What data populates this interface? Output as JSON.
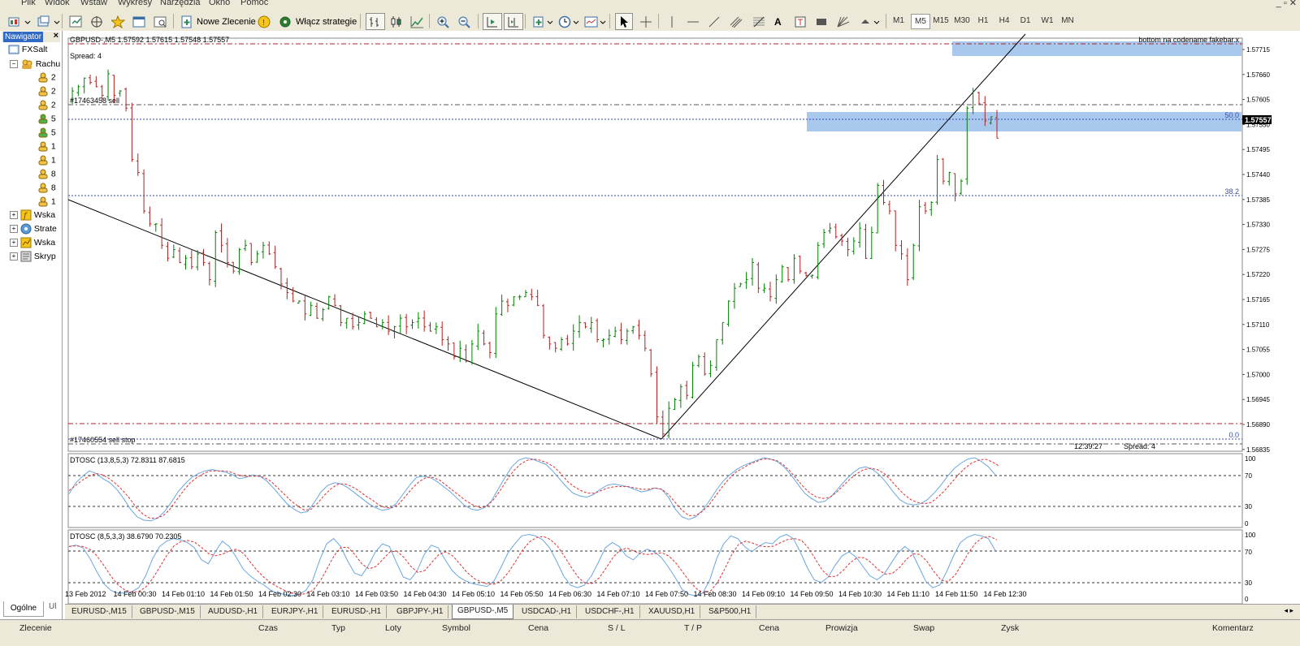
{
  "menu": [
    "Plik",
    "Widok",
    "Wstaw",
    "Wykresy",
    "Narzędzia",
    "Okno",
    "Pomoc"
  ],
  "toolbar": {
    "new_order_label": "Nowe Zlecenie",
    "strategies_label": "Włącz strategie",
    "timeframes": [
      "M1",
      "M5",
      "M15",
      "M30",
      "H1",
      "H4",
      "D1",
      "W1",
      "MN"
    ],
    "selected_timeframe": "M5",
    "text_tool": "A"
  },
  "navigator": {
    "title": "Nawigator",
    "root": "FXSalt",
    "accounts_label": "Rachu",
    "accounts": [
      "2",
      "2",
      "2",
      "5",
      "5",
      "1",
      "1",
      "8",
      "8",
      "1"
    ],
    "sections": [
      "Wska",
      "Strate",
      "Wska",
      "Skryp"
    ],
    "tab": "Ogólne",
    "tab2": "Ul"
  },
  "chart": {
    "header": "GBPUSD-,M5  1.57592 1.57615 1.57548 1.57557",
    "spread_label": "Spread: 4",
    "order_label_sell": "#17463458 sell",
    "order_label_stop": "#17460554 sell stop",
    "top_right_note": "bottom na codename fakebar.x",
    "current_price": "1.57557",
    "fib_labels": [
      "50.0",
      "38.2",
      "0.0"
    ],
    "countdown": "12:39:27",
    "spread_bottom": "Spread: 4",
    "price_ticks": [
      "1.57715",
      "1.57660",
      "1.57605",
      "1.57550",
      "1.57495",
      "1.57440",
      "1.57385",
      "1.57330",
      "1.57275",
      "1.57220",
      "1.57165",
      "1.57110",
      "1.57055",
      "1.57000",
      "1.56945",
      "1.56890",
      "1.56835"
    ],
    "time_ticks": [
      "13 Feb 2012",
      "14 Feb 00:30",
      "14 Feb 01:10",
      "14 Feb 01:50",
      "14 Feb 02:30",
      "14 Feb 03:10",
      "14 Feb 03:50",
      "14 Feb 04:30",
      "14 Feb 05:10",
      "14 Feb 05:50",
      "14 Feb 06:30",
      "14 Feb 07:10",
      "14 Feb 07:50",
      "14 Feb 08:30",
      "14 Feb 09:10",
      "14 Feb 09:50",
      "14 Feb 10:30",
      "14 Feb 11:10",
      "14 Feb 11:50",
      "14 Feb 12:30"
    ],
    "osc1_label": "DTOSC (13,8,5,3) 72.8311 87.6815",
    "osc2_label": "DTOSC (8,5,3,3) 38.6790 70.2305",
    "osc_ticks": [
      "100",
      "70",
      "30",
      "0"
    ],
    "colors": {
      "bull": "#008000",
      "bear": "#b22222",
      "zone": "#a8c8ee",
      "level": "#b22222",
      "osc_main": "#6aa6e0",
      "osc_signal": "#e03030"
    }
  },
  "chart_tabs": [
    "EURUSD-,M15",
    "GBPUSD-,M15",
    "AUDUSD-,H1",
    "EURJPY-,H1",
    "EURUSD-,H1",
    "GBPJPY-,H1",
    "GBPUSD-,M5",
    "USDCAD-,H1",
    "USDCHF-,H1",
    "XAUUSD,H1",
    "S&P500,H1"
  ],
  "selected_tab": "GBPUSD-,M5",
  "terminal_columns": [
    "Zlecenie",
    "Czas",
    "Typ",
    "Loty",
    "Symbol",
    "Cena",
    "S / L",
    "T / P",
    "Cena",
    "Prowizja",
    "Swap",
    "Zysk",
    "Komentarz"
  ],
  "chart_data": {
    "type": "candlestick",
    "symbol": "GBPUSD-",
    "timeframe": "M5",
    "ohlc_current": [
      1.57592,
      1.57615,
      1.57548,
      1.57557
    ],
    "ylim": [
      1.56835,
      1.5777
    ],
    "close_series": [
      1.5766,
      1.5767,
      1.5769,
      1.5768,
      1.5767,
      1.5765,
      1.577,
      1.5765,
      1.5766,
      1.5762,
      1.575,
      1.5747,
      1.5738,
      1.5735,
      1.5735,
      1.573,
      1.5727,
      1.5729,
      1.5726,
      1.5727,
      1.5725,
      1.5728,
      1.5726,
      1.5722,
      1.5733,
      1.573,
      1.5726,
      1.5724,
      1.5729,
      1.573,
      1.5726,
      1.5728,
      1.573,
      1.5728,
      1.5725,
      1.5721,
      1.5719,
      1.5717,
      1.5717,
      1.5714,
      1.5716,
      1.5713,
      1.5715,
      1.5718,
      1.5716,
      1.5712,
      1.5713,
      1.5711,
      1.5712,
      1.5714,
      1.5713,
      1.5711,
      1.5712,
      1.571,
      1.5711,
      1.5713,
      1.5711,
      1.5712,
      1.5713,
      1.5711,
      1.571,
      1.5711,
      1.5708,
      1.5707,
      1.5704,
      1.5706,
      1.5703,
      1.5707,
      1.571,
      1.5707,
      1.5705,
      1.5714,
      1.5717,
      1.5716,
      1.5718,
      1.5718,
      1.5719,
      1.5718,
      1.5716,
      1.5709,
      1.5707,
      1.5706,
      1.5708,
      1.5707,
      1.571,
      1.5712,
      1.5711,
      1.5712,
      1.5708,
      1.5708,
      1.5709,
      1.571,
      1.5708,
      1.571,
      1.5711,
      1.5709,
      1.5706,
      1.57,
      1.569,
      1.5686,
      1.5692,
      1.5694,
      1.5697,
      1.5695,
      1.5702,
      1.5704,
      1.57,
      1.5702,
      1.5708,
      1.5712,
      1.5717,
      1.572,
      1.5721,
      1.5722,
      1.5726,
      1.572,
      1.572,
      1.5718,
      1.5722,
      1.5725,
      1.5722,
      1.5727,
      1.5724,
      1.5723,
      1.5723,
      1.573,
      1.5733,
      1.5734,
      1.5732,
      1.5731,
      1.5729,
      1.5731,
      1.5734,
      1.5727,
      1.5733,
      1.5744,
      1.574,
      1.5738,
      1.573,
      1.5728,
      1.5722,
      1.573,
      1.5739,
      1.5738,
      1.574,
      1.575,
      1.5745,
      1.5747,
      1.5742,
      1.5745,
      1.5762,
      1.5766,
      1.5763,
      1.5759,
      1.576,
      1.5755
    ],
    "osc1_main": [
      45,
      62,
      72,
      80,
      76,
      68,
      62,
      52,
      38,
      22,
      10,
      5,
      4,
      8,
      18,
      32,
      48,
      60,
      70,
      76,
      80,
      82,
      80,
      78,
      74,
      68,
      70,
      74,
      72,
      65,
      54,
      42,
      30,
      22,
      16,
      18,
      32,
      48,
      58,
      62,
      60,
      54,
      46,
      38,
      30,
      24,
      20,
      22,
      30,
      44,
      58,
      70,
      72,
      70,
      64,
      56,
      48,
      38,
      28,
      22,
      20,
      24,
      34,
      52,
      70,
      86,
      96,
      100,
      98,
      94,
      90,
      80,
      68,
      56,
      46,
      42,
      40,
      44,
      52,
      58,
      60,
      58,
      56,
      52,
      48,
      50,
      54,
      52,
      40,
      22,
      10,
      6,
      10,
      20,
      34,
      50,
      64,
      74,
      82,
      88,
      92,
      96,
      100,
      98,
      94,
      86,
      74,
      60,
      46,
      38,
      32,
      34,
      42,
      54,
      66,
      76,
      84,
      86,
      82,
      74,
      62,
      48,
      36,
      30,
      28,
      30,
      36,
      46,
      58,
      72,
      84,
      92,
      98,
      100,
      94,
      86,
      74
    ],
    "osc1_signal": [
      50,
      58,
      66,
      72,
      76,
      74,
      68,
      60,
      50,
      38,
      24,
      14,
      8,
      8,
      12,
      22,
      36,
      50,
      62,
      70,
      76,
      80,
      80,
      80,
      78,
      74,
      72,
      72,
      72,
      70,
      64,
      54,
      44,
      34,
      26,
      20,
      22,
      32,
      44,
      54,
      60,
      60,
      56,
      50,
      42,
      36,
      28,
      24,
      24,
      30,
      42,
      54,
      64,
      70,
      70,
      66,
      58,
      50,
      42,
      34,
      28,
      24,
      26,
      36,
      50,
      66,
      80,
      90,
      96,
      98,
      96,
      92,
      86,
      76,
      64,
      56,
      50,
      46,
      46,
      50,
      54,
      56,
      56,
      56,
      54,
      52,
      52,
      54,
      52,
      44,
      32,
      20,
      12,
      12,
      18,
      28,
      42,
      56,
      68,
      78,
      84,
      90,
      94,
      98,
      98,
      96,
      90,
      80,
      68,
      56,
      46,
      40,
      38,
      40,
      48,
      58,
      68,
      76,
      82,
      84,
      82,
      76,
      66,
      54,
      44,
      36,
      32,
      30,
      32,
      40,
      50,
      62,
      74,
      84,
      92,
      96,
      98,
      94,
      88
    ],
    "osc2_main": [
      80,
      82,
      78,
      62,
      42,
      24,
      14,
      10,
      10,
      12,
      18,
      36,
      62,
      80,
      88,
      92,
      90,
      86,
      78,
      60,
      54,
      72,
      88,
      80,
      64,
      46,
      36,
      28,
      22,
      14,
      10,
      8,
      6,
      8,
      14,
      30,
      60,
      84,
      92,
      80,
      58,
      40,
      36,
      52,
      72,
      84,
      80,
      56,
      34,
      30,
      44,
      68,
      82,
      78,
      60,
      44,
      34,
      28,
      24,
      22,
      20,
      28,
      48,
      70,
      84,
      96,
      98,
      96,
      90,
      78,
      58,
      36,
      22,
      18,
      22,
      36,
      56,
      78,
      86,
      80,
      66,
      60,
      70,
      76,
      72,
      64,
      50,
      34,
      16,
      8,
      6,
      10,
      30,
      62,
      84,
      96,
      92,
      80,
      72,
      80,
      86,
      84,
      94,
      98,
      92,
      72,
      48,
      30,
      26,
      34,
      52,
      66,
      72,
      64,
      50,
      36,
      30,
      38,
      54,
      70,
      80,
      72,
      50,
      28,
      18,
      22,
      42,
      66,
      86,
      94,
      98,
      96,
      92,
      74
    ]
  }
}
